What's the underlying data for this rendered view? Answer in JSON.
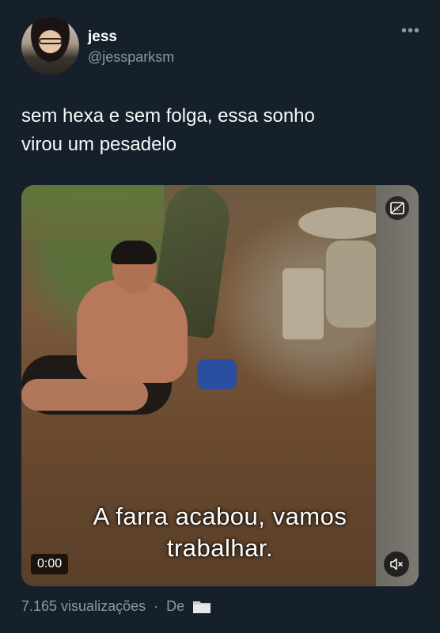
{
  "author": {
    "name": "jess",
    "handle": "@jessparksm"
  },
  "tweet": {
    "text_line1": "sem hexa e sem folga, essa sonho",
    "text_line2": "virou um pesadelo"
  },
  "video": {
    "subtitle_line1": "A farra acabou, vamos",
    "subtitle_line2": "trabalhar.",
    "timestamp": "0:00",
    "captions_icon": "closed-captions-icon",
    "mute_icon": "speaker-muted-icon"
  },
  "meta": {
    "views": "7.165 visualizações",
    "separator": "·",
    "source_label": "De",
    "source_icon": "folder-icon"
  },
  "colors": {
    "background": "#15202b",
    "secondary_text": "#8b98a5"
  }
}
